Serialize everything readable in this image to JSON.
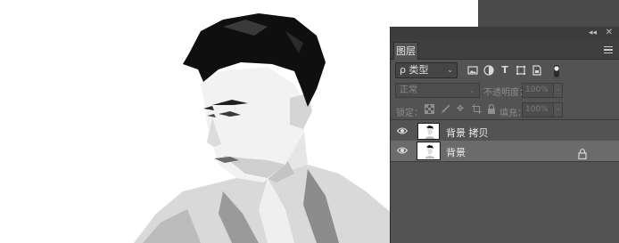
{
  "canvas": {
    "image_subject": "man-portrait-bw"
  },
  "panel": {
    "collapse_icon": "double-chevron-icon",
    "close_icon": "close-icon",
    "tab_label": "图层",
    "menu_icon": "panel-menu-icon",
    "filter": {
      "kind_label": "ρ 类型",
      "icons": [
        "image-filter-icon",
        "adjustment-filter-icon",
        "type-filter-icon",
        "shape-filter-icon",
        "smartobject-filter-icon",
        "filter-toggle-icon"
      ]
    },
    "blend_mode": "正常",
    "opacity_label": "不透明度：",
    "opacity_value": "100%",
    "lock_label": "锁定：",
    "lock_icons": [
      "lock-transparent-icon",
      "lock-brush-icon",
      "lock-move-icon",
      "lock-artboard-icon",
      "lock-all-icon"
    ],
    "fill_label": "填充：",
    "fill_value": "100%",
    "layers": [
      {
        "name": "背景 拷贝",
        "visible": true,
        "selected": false,
        "locked": false
      },
      {
        "name": "背景",
        "visible": true,
        "selected": true,
        "locked": true
      }
    ]
  }
}
